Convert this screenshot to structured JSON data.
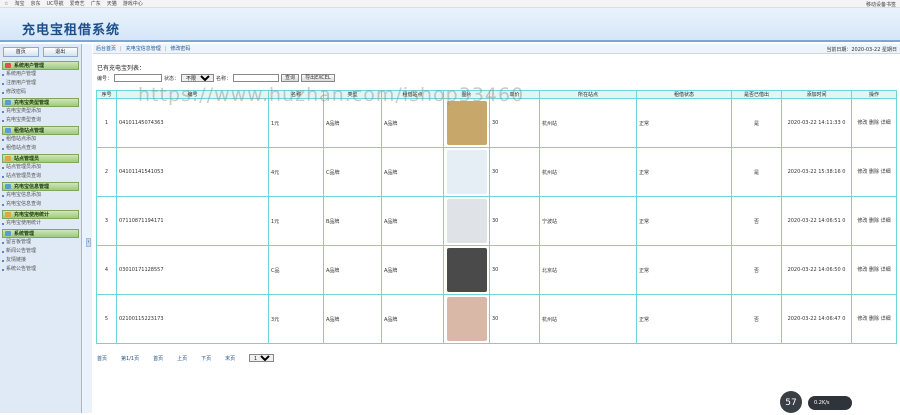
{
  "browser": {
    "bookmarks": [
      "淘宝",
      "京东",
      "UC导航",
      "爱奇艺",
      "广东",
      "天猫",
      "游戏中心"
    ],
    "right_label": "移动设备书签"
  },
  "app": {
    "title": "充电宝租借系统"
  },
  "sidebar": {
    "buttons": [
      "首页",
      "退出"
    ],
    "groups": [
      {
        "label": "系统用户管理",
        "icon_color": "#d9534f",
        "items": [
          "系统用户管理",
          "注册用户管理",
          "修改密码"
        ]
      },
      {
        "label": "充电宝类型管理",
        "icon_color": "#5b9bd5",
        "items": [
          "充电宝类型添加",
          "充电宝类型查询"
        ]
      },
      {
        "label": "租借站点管理",
        "icon_color": "#5b9bd5",
        "items": [
          "租借站点添加",
          "租借站点查询"
        ]
      },
      {
        "label": "站点管理员",
        "icon_color": "#e8a33b",
        "items": [
          "站点管理员添加",
          "站点管理员查询"
        ]
      },
      {
        "label": "充电宝信息管理",
        "icon_color": "#5b9bd5",
        "items": [
          "充电宝信息添加",
          "充电宝信息查询"
        ]
      },
      {
        "label": "充电宝使用统计",
        "icon_color": "#e8a33b",
        "items": [
          "充电宝使用统计"
        ]
      },
      {
        "label": "系统管理",
        "icon_color": "#5b9bd5",
        "items": [
          "留言板管理",
          "新闻公告管理",
          "友情链接",
          "系统公告管理"
        ]
      }
    ]
  },
  "topbar": {
    "crumbs": [
      "后台首页",
      "充电宝信息管理",
      "修改密码"
    ],
    "date": "当前日期：2020-03-22 星期日"
  },
  "main": {
    "section_title": "已有充电宝列表：",
    "search": {
      "label_code": "编号：",
      "label_status": "状态：",
      "status_value": "不限",
      "label_name": "名称：",
      "search_button": "查询",
      "export_button": "导出EXCEL"
    },
    "watermark": "https://www.huzhan.com/ishop33460",
    "columns": [
      "序号",
      "编号",
      "名称",
      "类型",
      "租借站点",
      "图片",
      "单价",
      "所在站点",
      "租借状态",
      "是否已借出",
      "添加时间",
      "操作"
    ],
    "rows": [
      {
        "no": "1",
        "code": "04101145074363",
        "name": "1元",
        "type": "A品牌",
        "site": "A品牌",
        "price": "30",
        "location": "杭州站",
        "status": "正常",
        "lent": "是",
        "time": "2020-03-22 14:11:33 0",
        "op": "修改 删除 详细"
      },
      {
        "no": "2",
        "code": "04101141541053",
        "name": "4元",
        "type": "C品牌",
        "site": "A品牌",
        "price": "30",
        "location": "杭州站",
        "status": "正常",
        "lent": "是",
        "time": "2020-03-22 15:38:16 0",
        "op": "修改 删除 详细"
      },
      {
        "no": "3",
        "code": "07110871194171",
        "name": "1元",
        "type": "B品牌",
        "site": "A品牌",
        "price": "30",
        "location": "宁波站",
        "status": "正常",
        "lent": "否",
        "time": "2020-03-22 14:06:51 0",
        "op": "修改 删除 详细"
      },
      {
        "no": "4",
        "code": "03010171128557",
        "name": "C品",
        "type": "A品牌",
        "site": "A品牌",
        "price": "30",
        "location": "北京站",
        "status": "正常",
        "lent": "否",
        "time": "2020-03-22 14:06:50 0",
        "op": "修改 删除 详细"
      },
      {
        "no": "5",
        "code": "02100115223173",
        "name": "3元",
        "type": "A品牌",
        "site": "A品牌",
        "price": "30",
        "location": "杭州站",
        "status": "正常",
        "lent": "否",
        "time": "2020-03-22 14:06:47 0",
        "op": "修改 删除 详细"
      }
    ],
    "thumbs": [
      "#c8a86a",
      "#e6eef5",
      "#dfe3e8",
      "#4a4a4a",
      "#d9b8a8"
    ],
    "pager": [
      "首页",
      "第1/1页",
      "首页",
      "上页",
      "下页",
      "末页"
    ],
    "pager_select": "1"
  },
  "overlay": {
    "speed": "57",
    "net": "0.2K/s"
  }
}
